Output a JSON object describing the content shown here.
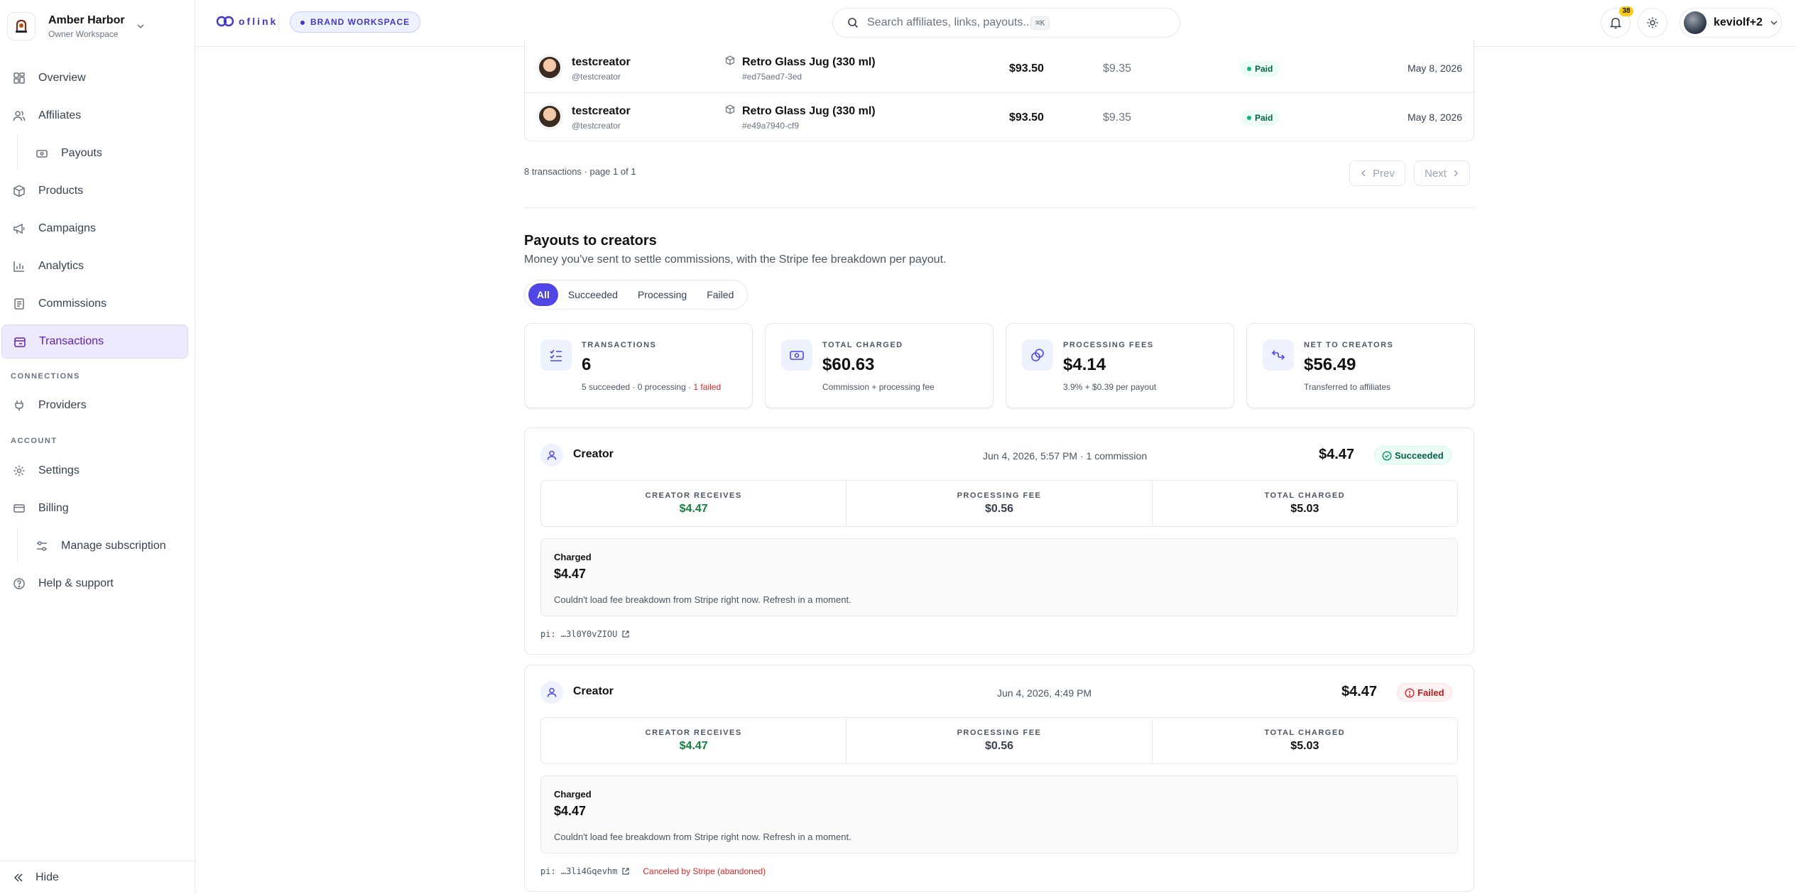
{
  "workspace": {
    "name": "Amber Harbor",
    "subtitle": "Owner Workspace"
  },
  "nav": {
    "overview": "Overview",
    "affiliates": "Affiliates",
    "payouts": "Payouts",
    "products": "Products",
    "campaigns": "Campaigns",
    "analytics": "Analytics",
    "commissions": "Commissions",
    "transactions": "Transactions",
    "connections_label": "CONNECTIONS",
    "providers": "Providers",
    "account_label": "ACCOUNT",
    "settings": "Settings",
    "billing": "Billing",
    "manage_subscription": "Manage subscription",
    "help": "Help & support",
    "hide": "Hide"
  },
  "topbar": {
    "brand": "oflink",
    "workspace_badge": "BRAND WORKSPACE",
    "search_placeholder": "Search affiliates, links, payouts...",
    "search_shortcut": "⌘K",
    "notification_count": "38",
    "user_name": "keviolf+2"
  },
  "transactions": {
    "rows": [
      {
        "creator": "testcreator",
        "handle": "@testcreator",
        "product": "Retro Glass Jug (330 ml)",
        "product_id": "#ed75aed7-3ed",
        "amount": "$93.50",
        "commission": "$9.35",
        "status": "Paid",
        "date": "May 8, 2026"
      },
      {
        "creator": "testcreator",
        "handle": "@testcreator",
        "product": "Retro Glass Jug (330 ml)",
        "product_id": "#e49a7940-cf9",
        "amount": "$93.50",
        "commission": "$9.35",
        "status": "Paid",
        "date": "May 8, 2026"
      }
    ],
    "pager_info": "8 transactions · page 1 of 1",
    "prev": "Prev",
    "next": "Next"
  },
  "payouts": {
    "title": "Payouts to creators",
    "description": "Money you've sent to settle commissions, with the Stripe fee breakdown per payout.",
    "filters": [
      "All",
      "Succeeded",
      "Processing",
      "Failed"
    ],
    "stats": [
      {
        "label": "TRANSACTIONS",
        "value": "6",
        "sub": "5 succeeded · 0 processing · ",
        "sub_fail": "1 failed"
      },
      {
        "label": "TOTAL CHARGED",
        "value": "$60.63",
        "sub": "Commission + processing fee"
      },
      {
        "label": "PROCESSING FEES",
        "value": "$4.14",
        "sub": "3.9% + $0.39 per payout"
      },
      {
        "label": "NET TO CREATORS",
        "value": "$56.49",
        "sub": "Transferred to affiliates"
      }
    ],
    "cards": [
      {
        "title": "Creator",
        "meta": "Jun 4, 2026, 5:57 PM · 1 commission",
        "amount": "$4.47",
        "status": "Succeeded",
        "breakdown": [
          {
            "label": "CREATOR RECEIVES",
            "value": "$4.47"
          },
          {
            "label": "PROCESSING FEE",
            "value": "$0.56"
          },
          {
            "label": "TOTAL CHARGED",
            "value": "$5.03"
          }
        ],
        "charged_title": "Charged",
        "charged_amount": "$4.47",
        "message": "Couldn't load fee breakdown from Stripe right now. Refresh in a moment.",
        "pi": "pi: …3l0Y0vZIOU",
        "cancel_note": ""
      },
      {
        "title": "Creator",
        "meta": "Jun 4, 2026, 4:49 PM",
        "amount": "$4.47",
        "status": "Failed",
        "breakdown": [
          {
            "label": "CREATOR RECEIVES",
            "value": "$4.47"
          },
          {
            "label": "PROCESSING FEE",
            "value": "$0.56"
          },
          {
            "label": "TOTAL CHARGED",
            "value": "$5.03"
          }
        ],
        "charged_title": "Charged",
        "charged_amount": "$4.47",
        "message": "Couldn't load fee breakdown from Stripe right now. Refresh in a moment.",
        "pi": "pi: …3li4Gqevhm",
        "cancel_note": "Canceled by Stripe (abandoned)"
      }
    ]
  },
  "colors": {
    "accent": "#4f46e5",
    "active_nav_bg": "#ede9fe",
    "success": "#15803d",
    "danger": "#dc2626"
  },
  "icons": [
    "chevron-down-icon",
    "grid-icon",
    "users-icon",
    "wallet-icon",
    "box-icon",
    "megaphone-icon",
    "bar-chart-icon",
    "receipt-icon",
    "card-icon",
    "plug-icon",
    "gear-icon",
    "sliders-icon",
    "help-icon",
    "chevrons-left-icon",
    "search-icon",
    "bell-icon",
    "sun-icon",
    "check-list-icon",
    "cash-icon",
    "coins-icon",
    "send-icon",
    "user-icon",
    "check-circle-icon",
    "alert-circle-icon",
    "external-link-icon"
  ]
}
